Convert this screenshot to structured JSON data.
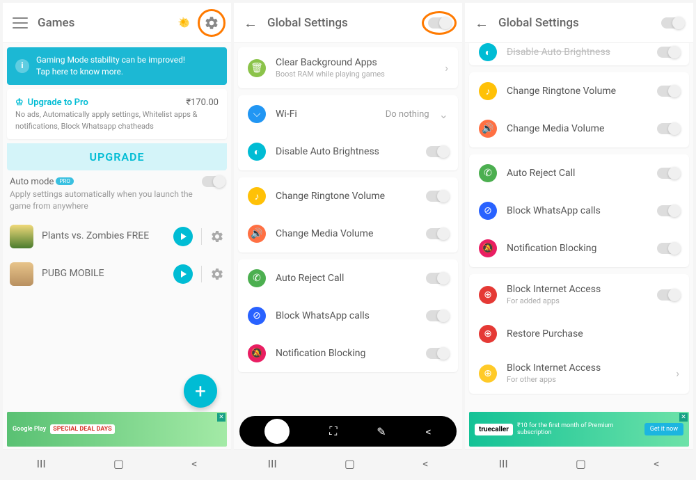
{
  "p1": {
    "title": "Games",
    "banner": {
      "line1": "Gaming Mode stability can be improved!",
      "line2": "Tap here to know more."
    },
    "pro": {
      "title": "Upgrade to Pro",
      "price": "₹170.00",
      "desc": "No ads, Automatically apply settings, Whitelist apps & notifications, Block Whatsapp chatheads",
      "btn": "UPGRADE"
    },
    "automode": {
      "title": "Auto mode",
      "badge": "PRO",
      "desc": "Apply settings automatically when you launch the game from anywhere"
    },
    "games": [
      {
        "name": "Plants vs. Zombies FREE"
      },
      {
        "name": "PUBG MOBILE"
      }
    ],
    "ad": {
      "t1": "Google Play",
      "t2": "SPECIAL DEAL DAYS"
    }
  },
  "p2": {
    "title": "Global Settings",
    "clear": {
      "title": "Clear Background Apps",
      "sub": "Boost RAM while playing games"
    },
    "wifi": {
      "label": "Wi-Fi",
      "value": "Do nothing"
    },
    "brightness": "Disable Auto Brightness",
    "ringtone": "Change Ringtone Volume",
    "media": "Change Media Volume",
    "reject": "Auto Reject Call",
    "blockwa": "Block WhatsApp calls",
    "notif": "Notification Blocking"
  },
  "p3": {
    "title": "Global Settings",
    "brightness": "Disable Auto Brightness",
    "ringtone": "Change Ringtone Volume",
    "media": "Change Media Volume",
    "reject": "Auto Reject Call",
    "blockwa": "Block WhatsApp calls",
    "notif": "Notification Blocking",
    "bia": {
      "title": "Block Internet Access",
      "sub": "For added apps"
    },
    "restore": "Restore Purchase",
    "bio": {
      "title": "Block Internet Access",
      "sub": "For other apps"
    },
    "ad": {
      "brand": "truecaller",
      "txt": "₹10 for the first month of Premium subscription",
      "btn": "Get it now"
    }
  }
}
